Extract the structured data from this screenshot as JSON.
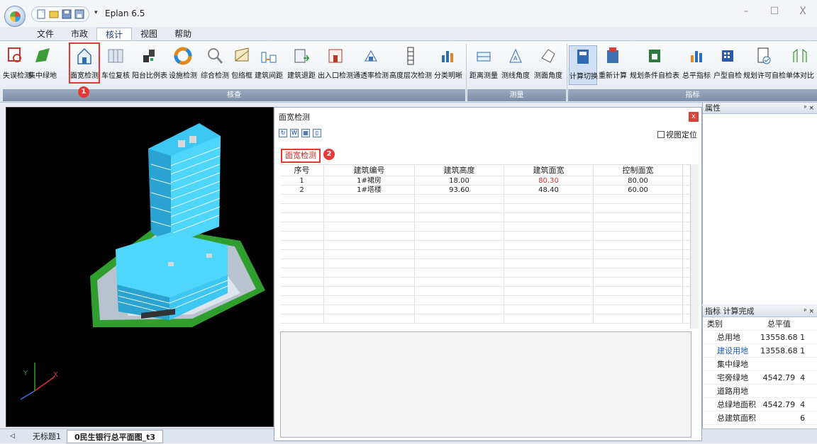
{
  "window": {
    "title": "Eplan 6.5",
    "minimize": "–",
    "maximize": "☐",
    "close": "X"
  },
  "menu": [
    "文件",
    "市政",
    "核计",
    "视图",
    "帮助"
  ],
  "menu_active": 2,
  "ribbon": {
    "check_group": "核查",
    "measure_group": "测量",
    "index_group": "指标",
    "buttons": [
      "失误检测",
      "集中绿地",
      "面宽检测",
      "车位复核",
      "阳台比例表",
      "设施检测",
      "综合检测",
      "包络框",
      "建筑间距",
      "建筑退距",
      "出入口检测",
      "通透率检测",
      "高度层次检测",
      "分类明晰",
      "距离测量",
      "测线角度",
      "测面角度",
      "计算切换",
      "重新计算",
      "规划条件自检表",
      "总平指标",
      "户型自检",
      "规划许可自检",
      "单体对比"
    ]
  },
  "annotations": {
    "marker1": "1",
    "marker2": "2"
  },
  "dialog": {
    "title": "面宽检测",
    "close": "x",
    "locate_label": "视图定位",
    "tab_label": "面宽检测",
    "columns": [
      "序号",
      "建筑编号",
      "建筑高度",
      "建筑面宽",
      "控制面宽"
    ],
    "rows": [
      [
        "1",
        "1#裙房",
        "18.00",
        "80.30",
        "80.00"
      ],
      [
        "2",
        "1#塔楼",
        "93.60",
        "48.40",
        "60.00"
      ]
    ],
    "highlight_color": "#d32f2f"
  },
  "props_panel": {
    "title": "属性",
    "pin": "ᵖ ×"
  },
  "metrics_panel": {
    "title": "指标  计算完成",
    "pin": "ᵖ ×",
    "header": [
      "类别",
      "总平值"
    ],
    "rows": [
      {
        "name": "总用地",
        "value": "13558.68",
        "extra": "1"
      },
      {
        "name": "建设用地",
        "value": "13558.68",
        "extra": "1"
      },
      {
        "name": "集中绿地",
        "value": "",
        "extra": ""
      },
      {
        "name": "宅旁绿地",
        "value": "4542.79",
        "extra": "4"
      },
      {
        "name": "道路用地",
        "value": "",
        "extra": ""
      },
      {
        "name": "总绿地面积",
        "value": "4542.79",
        "extra": "4"
      },
      {
        "name": "总建筑面积",
        "value": "",
        "extra": "6"
      }
    ]
  },
  "doc_tabs": [
    "无标题1",
    "0民生银行总平面图_t3"
  ],
  "axis": {
    "x": "X",
    "y": "Y"
  }
}
